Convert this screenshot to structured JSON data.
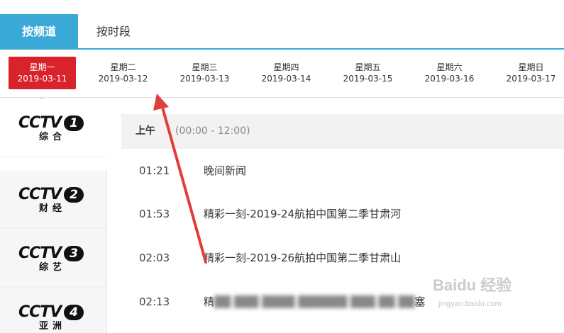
{
  "tabs": [
    {
      "label": "按频道",
      "active": true
    },
    {
      "label": "按时段",
      "active": false
    }
  ],
  "days": [
    {
      "weekday": "星期一",
      "date": "2019-03-11",
      "active": true
    },
    {
      "weekday": "星期二",
      "date": "2019-03-12",
      "active": false
    },
    {
      "weekday": "星期三",
      "date": "2019-03-13",
      "active": false
    },
    {
      "weekday": "星期四",
      "date": "2019-03-14",
      "active": false
    },
    {
      "weekday": "星期五",
      "date": "2019-03-15",
      "active": false
    },
    {
      "weekday": "星期六",
      "date": "2019-03-16",
      "active": false
    },
    {
      "weekday": "星期日",
      "date": "2019-03-17",
      "active": false
    }
  ],
  "channels": [
    {
      "brand": "CCTV",
      "number": "1",
      "name": "综合",
      "active": true
    },
    {
      "brand": "CCTV",
      "number": "2",
      "name": "财经",
      "active": false
    },
    {
      "brand": "CCTV",
      "number": "3",
      "name": "综艺",
      "active": false
    },
    {
      "brand": "CCTV",
      "number": "4",
      "name": "亚洲",
      "active": false
    }
  ],
  "schedule": {
    "period_label": "上午",
    "period_range": "(00:00 - 12:00)",
    "programs": [
      {
        "time": "01:21",
        "title": "晚间新闻"
      },
      {
        "time": "01:53",
        "title": "精彩一刻-2019-24航拍中国第二季甘肃河"
      },
      {
        "time": "02:03",
        "title": "精彩一刻-2019-26航拍中国第二季甘肃山"
      },
      {
        "time": "02:13",
        "title_prefix": "精",
        "title_suffix": "塞"
      }
    ]
  },
  "watermark": {
    "main": "Baidu 经验",
    "sub": "jingyan.baidu.com"
  },
  "colors": {
    "accent_blue": "#3aa9d8",
    "active_red": "#d9222a",
    "arrow_red": "#e23c3c"
  }
}
